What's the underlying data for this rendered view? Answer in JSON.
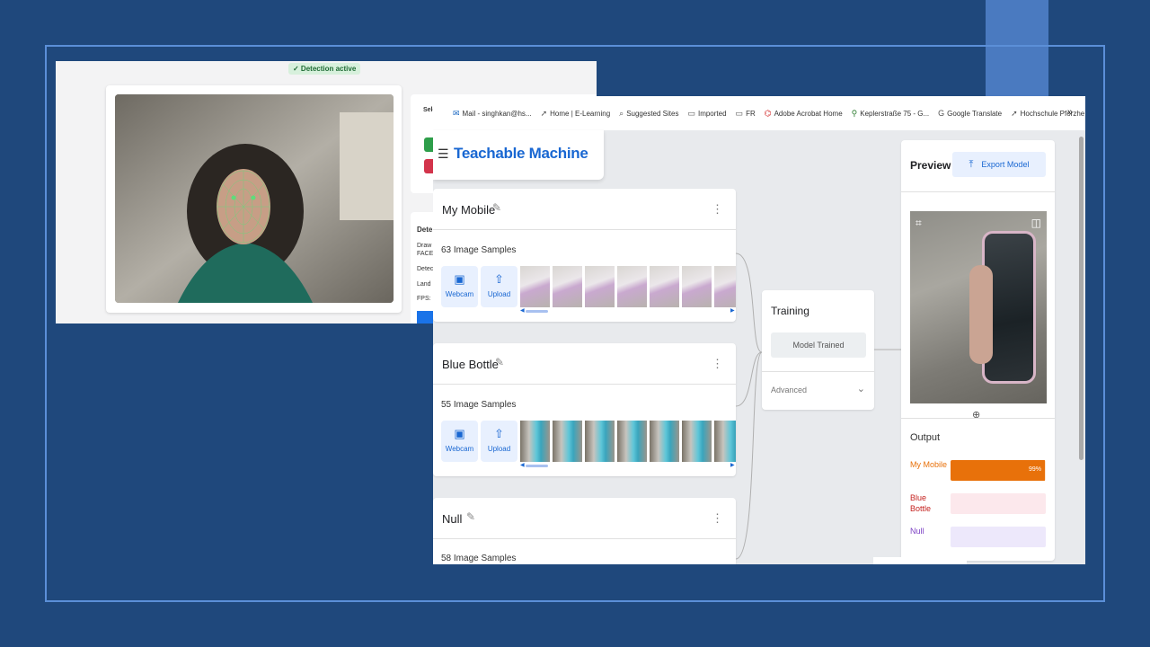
{
  "face_app": {
    "badge": "✓ Detection active",
    "side_labels": [
      "Selec",
      "Dete",
      "Draw",
      "FACE",
      "Detec",
      "Land",
      "FPS:"
    ]
  },
  "teachable": {
    "bookmarks": [
      {
        "icon": "outlook-icon",
        "label": "Mail - singhkan@hs..."
      },
      {
        "icon": "link-icon",
        "label": "Home | E-Learning"
      },
      {
        "icon": "search-icon",
        "label": "Suggested Sites"
      },
      {
        "icon": "folder-icon",
        "label": "Imported"
      },
      {
        "icon": "folder-icon",
        "label": "FR"
      },
      {
        "icon": "acrobat-icon",
        "label": "Adobe Acrobat Home"
      },
      {
        "icon": "map-pin-icon",
        "label": "Keplerstraße 75 - G..."
      },
      {
        "icon": "translate-icon",
        "label": "Google Translate"
      },
      {
        "icon": "link-icon",
        "label": "Hochschule Pforzhe..."
      }
    ],
    "more": "»",
    "title": "Teachable Machine",
    "classes": [
      {
        "name": "My Mobile",
        "samples": "63 Image Samples",
        "thumb": "phone"
      },
      {
        "name": "Blue Bottle",
        "samples": "55 Image Samples",
        "thumb": "bottle"
      },
      {
        "name": "Null",
        "samples": "58 Image Samples",
        "thumb": ""
      }
    ],
    "webcam_label": "Webcam",
    "upload_label": "Upload",
    "training": {
      "title": "Training",
      "button": "Model Trained",
      "advanced": "Advanced"
    },
    "preview": {
      "title": "Preview",
      "export": "Export Model",
      "output_label": "Output",
      "outputs": [
        {
          "label": "My Mobile",
          "value": 0.99,
          "pct": "99%",
          "color": "#e8710a",
          "bg": "#fde5cf"
        },
        {
          "label": "Blue Bottle",
          "value": 0.0,
          "pct": "",
          "color": "#c5221f",
          "bg": "#fce8ec"
        },
        {
          "label": "Null",
          "value": 0.0,
          "pct": "",
          "color": "#7b3fc4",
          "bg": "#ede8fb"
        }
      ]
    }
  }
}
